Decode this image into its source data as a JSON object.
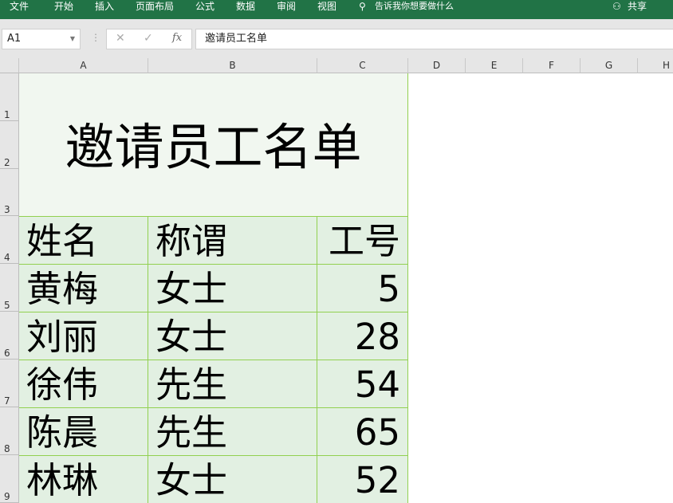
{
  "ribbon": {
    "tabs": [
      "文件",
      "开始",
      "插入",
      "页面布局",
      "公式",
      "数据",
      "审阅",
      "视图"
    ],
    "tell_me": "告诉我你想要做什么",
    "share": "共享"
  },
  "formula_bar": {
    "name_box": "A1",
    "value": "邀请员工名单"
  },
  "columns": [
    "A",
    "B",
    "C",
    "D",
    "E",
    "F",
    "G",
    "H"
  ],
  "rows": [
    "1",
    "2",
    "3",
    "4",
    "5",
    "6",
    "7",
    "8",
    "9"
  ],
  "sheet": {
    "title": "邀请员工名单",
    "headers": [
      "姓名",
      "称谓",
      "工号"
    ],
    "data": [
      [
        "黄梅",
        "女士",
        "5"
      ],
      [
        "刘丽",
        "女士",
        "28"
      ],
      [
        "徐伟",
        "先生",
        "54"
      ],
      [
        "陈晨",
        "先生",
        "65"
      ],
      [
        "林琳",
        "女士",
        "52"
      ]
    ]
  }
}
